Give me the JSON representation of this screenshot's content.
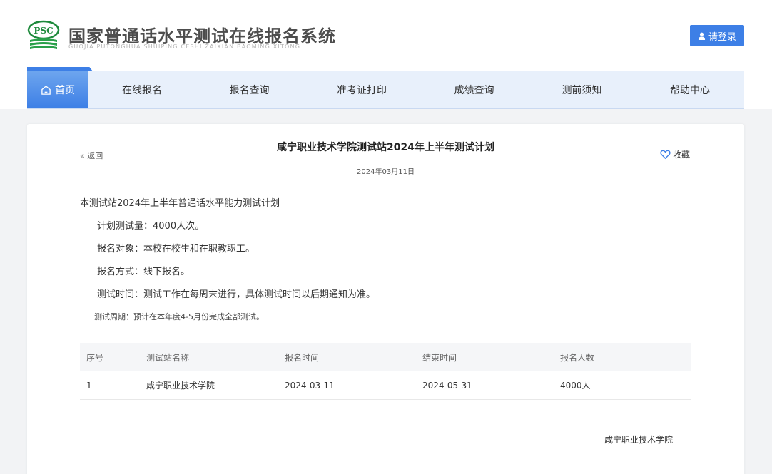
{
  "header": {
    "logo_text": "PSC",
    "title": "国家普通话水平测试在线报名系统",
    "subtitle": "GUOJIA PUTONGHUA SHUIPING CESHI ZAIXIAN BAOMING XITONG",
    "login_label": "请登录",
    "brand_color": "#3d7fe6"
  },
  "nav": {
    "items": [
      {
        "label": "首页",
        "icon": "home-icon",
        "active": true
      },
      {
        "label": "在线报名"
      },
      {
        "label": "报名查询"
      },
      {
        "label": "准考证打印"
      },
      {
        "label": "成绩查询"
      },
      {
        "label": "测前须知"
      },
      {
        "label": "帮助中心"
      }
    ]
  },
  "article": {
    "back_label": "« 返回",
    "title": "咸宁职业技术学院测试站2024年上半年测试计划",
    "date": "2024年03月11日",
    "favorite_label": "收藏",
    "paragraphs": [
      "本测试站2024年上半年普通话水平能力测试计划",
      "计划测试量：4000人次。",
      "报名对象：本校在校生和在职教职工。",
      "报名方式：线下报名。",
      "测试时间：测试工作在每周末进行，具体测试时间以后期通知为准。",
      "测试周期：预计在本年度4-5月份完成全部测试。"
    ],
    "table": {
      "headers": [
        "序号",
        "测试站名称",
        "报名时间",
        "结束时间",
        "报名人数"
      ],
      "rows": [
        [
          "1",
          "咸宁职业技术学院",
          "2024-03-11",
          "2024-05-31",
          "4000人"
        ]
      ]
    },
    "signature": "咸宁职业技术学院"
  }
}
